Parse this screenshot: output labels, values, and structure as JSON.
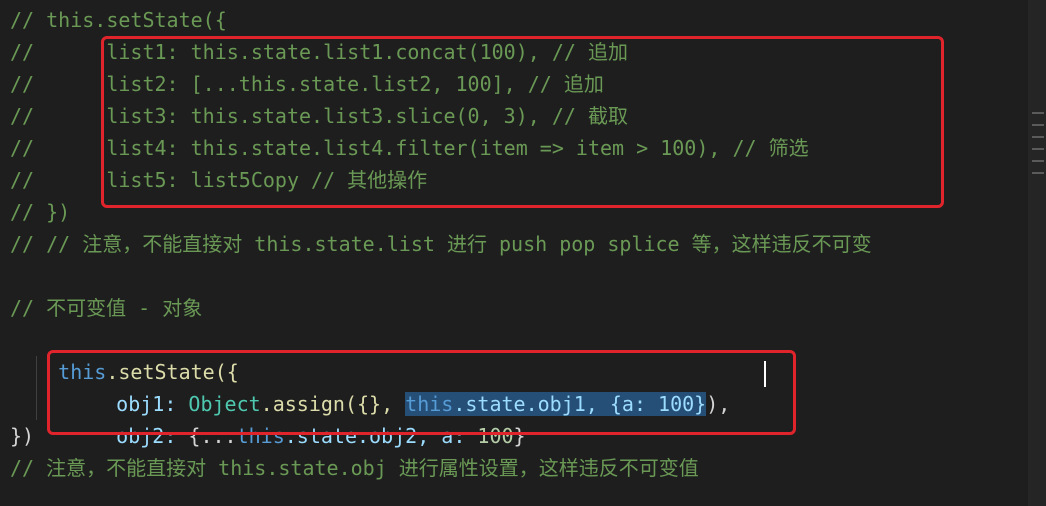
{
  "editor": {
    "lines": [
      {
        "id": "l0",
        "text": "// this.setState({"
      },
      {
        "id": "l1",
        "text": "//      list1: this.state.list1.concat(100), // 追加"
      },
      {
        "id": "l2",
        "text": "//      list2: [...this.state.list2, 100], // 追加"
      },
      {
        "id": "l3",
        "text": "//      list3: this.state.list3.slice(0, 3), // 截取"
      },
      {
        "id": "l4",
        "text": "//      list4: this.state.list4.filter(item => item > 100), // 筛选"
      },
      {
        "id": "l5",
        "text": "//      list5: list5Copy // 其他操作"
      },
      {
        "id": "l6",
        "text": "// })"
      },
      {
        "id": "l7",
        "text": "// // 注意，不能直接对 this.state.list 进行 push pop splice 等，这样违反不可变"
      },
      {
        "id": "l8",
        "text": ""
      },
      {
        "id": "l9",
        "text": "// 不可变值 - 对象"
      }
    ],
    "code": {
      "this_kw": "this",
      "set_state": ".setState({",
      "obj1_key": "obj1: ",
      "object_cls": "Object",
      "assign_call": ".assign({}, ",
      "selected_text_this": "this",
      "selected_text_rest": ".state.obj1, {a: 100}",
      "obj1_tail": "),",
      "obj2_key": "obj2: ",
      "obj2_open": "{...",
      "obj2_this": "this",
      "obj2_rest": ".state.obj2, a: ",
      "obj2_num": "100",
      "obj2_close": "}",
      "close": "})",
      "final_comment": "// 注意，不能直接对 this.state.obj 进行属性设置，这样违反不可变值"
    }
  },
  "colors": {
    "background": "#1e1e1e",
    "comment": "#6a9955",
    "keyword": "#569cd6",
    "highlight_box": "#e0242c",
    "selection": "#264f78"
  }
}
